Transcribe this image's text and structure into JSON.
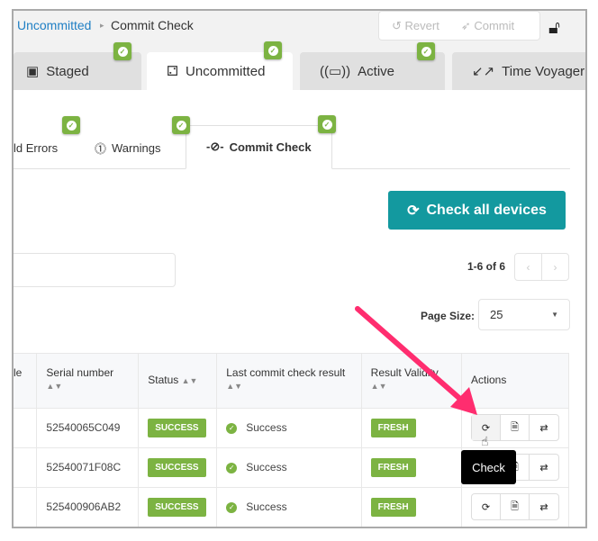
{
  "breadcrumb": {
    "parent": "Uncommitted",
    "current": "Commit Check"
  },
  "header": {
    "revert": "Revert",
    "commit": "Commit"
  },
  "tabs": [
    {
      "label": "Staged"
    },
    {
      "label": "Uncommitted"
    },
    {
      "label": "Active"
    },
    {
      "label": "Time Voyager"
    }
  ],
  "subtabs": [
    {
      "label": "ld Errors"
    },
    {
      "label": "Warnings"
    },
    {
      "label": "Commit Check"
    }
  ],
  "check_all": "Check all devices",
  "pagination": {
    "range": "1-6 of 6",
    "page_size_label": "Page Size:",
    "page_size": "25"
  },
  "table": {
    "headers": [
      "le",
      "Serial number",
      "Status",
      "Last commit check result",
      "Result Validity",
      "Actions"
    ],
    "rows": [
      {
        "serial": "52540065C049",
        "status": "SUCCESS",
        "result": "Success",
        "validity": "FRESH"
      },
      {
        "serial": "52540071F08C",
        "status": "SUCCESS",
        "result": "Success",
        "validity": "FRESH"
      },
      {
        "serial": "525400906AB2",
        "status": "SUCCESS",
        "result": "Success",
        "validity": "FRESH"
      }
    ]
  },
  "tooltip": "Check",
  "colors": {
    "accent": "#13999f",
    "success": "#7cb342",
    "link": "#1f7fc4",
    "arrow": "#ff2d6f"
  }
}
